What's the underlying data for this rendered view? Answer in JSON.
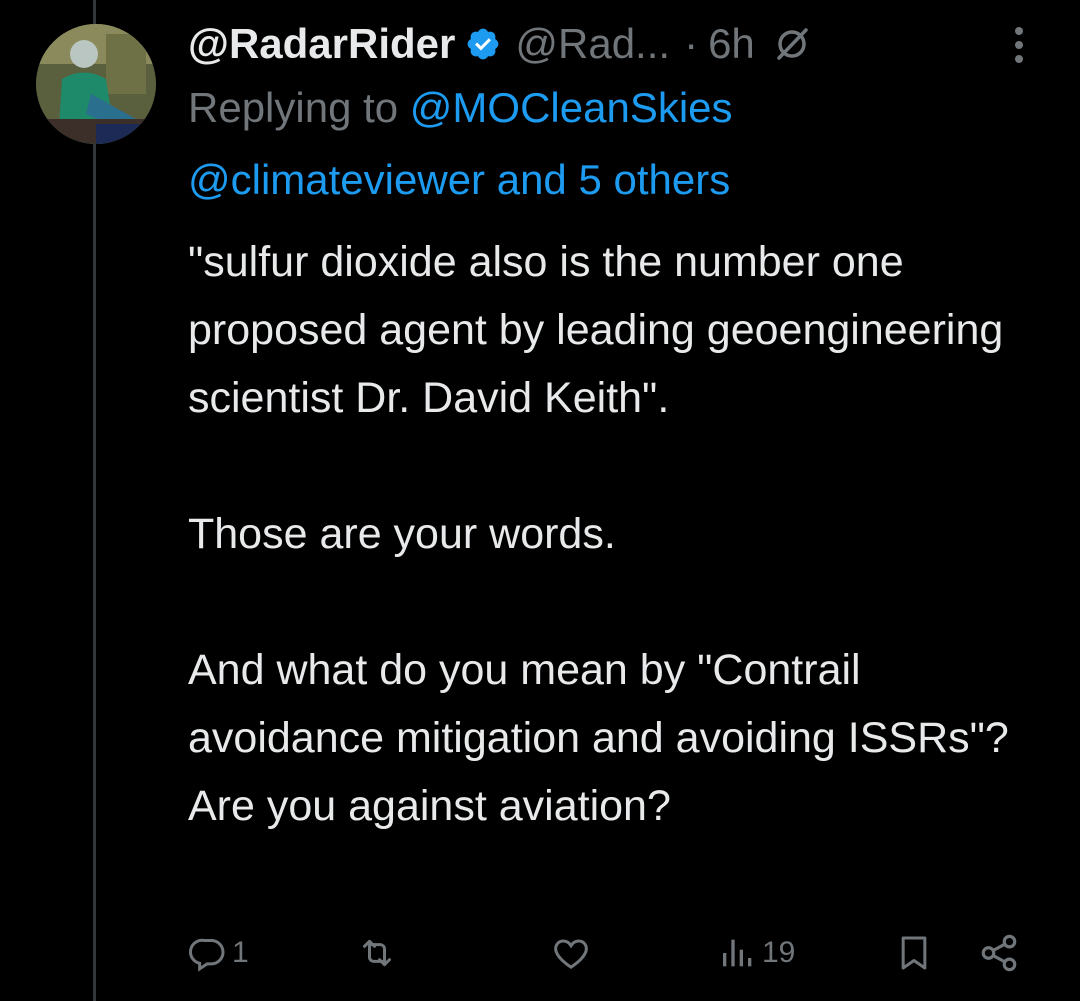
{
  "tweet": {
    "display_name": "@RadarRider",
    "handle": "@Rad...",
    "separator": "·",
    "time": "6h",
    "replying_prefix": "Replying to",
    "replying_to_first": "@MOCleanSkies",
    "replying_to_rest": "@climateviewer and 5 others",
    "paragraphs": [
      "\"sulfur dioxide also is the number one proposed agent by leading geoengineering scientist Dr. David Keith\".",
      "Those are your words.",
      "And what do you mean by \"Contrail avoidance mitigation and avoiding ISSRs\"? Are you against aviation?"
    ]
  },
  "actions": {
    "reply_count": "1",
    "retweet_count": "",
    "like_count": "",
    "views_count": "19"
  },
  "icons": {
    "verified": "verified-badge-icon",
    "no_slash": "grok-slash-icon",
    "more": "more-vertical-icon",
    "reply": "reply-icon",
    "retweet": "retweet-icon",
    "like": "heart-icon",
    "views": "views-icon",
    "bookmark": "bookmark-icon",
    "share": "share-icon"
  },
  "colors": {
    "background": "#000000",
    "text": "#e7e9ea",
    "muted": "#71767b",
    "accent": "#1d9bf0"
  }
}
